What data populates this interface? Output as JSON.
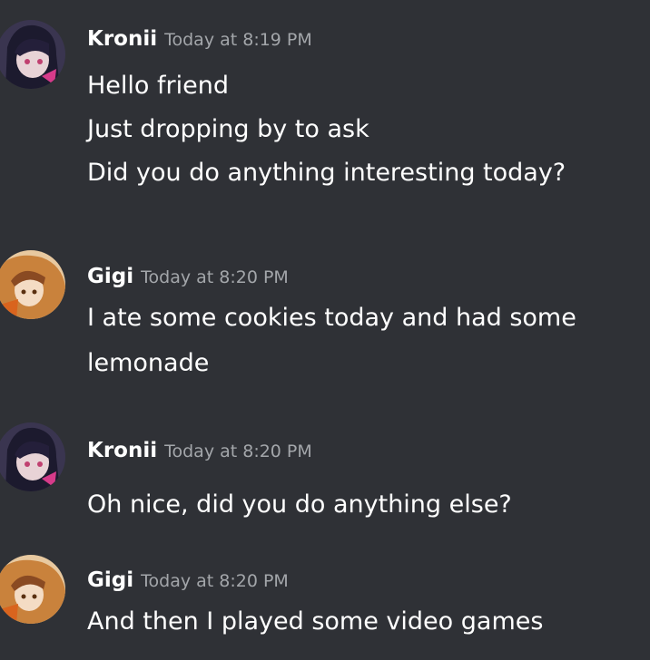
{
  "colors": {
    "background": "#2f3136",
    "username": "#ffffff",
    "timestamp": "#a3a6aa",
    "message_text": "#ffffff"
  },
  "messages": [
    {
      "author": "Kronii",
      "timestamp": "Today at 8:19 PM",
      "avatar_icon": "kronii-avatar",
      "lines": [
        "Hello friend",
        "Just dropping by to ask",
        "Did you do anything interesting today?"
      ]
    },
    {
      "author": "Gigi",
      "timestamp": "Today at 8:20 PM",
      "avatar_icon": "gigi-avatar",
      "lines": [
        "I ate some cookies today and had some",
        "lemonade"
      ]
    },
    {
      "author": "Kronii",
      "timestamp": "Today at 8:20 PM",
      "avatar_icon": "kronii-avatar",
      "lines": [
        "Oh nice, did you do anything else?"
      ]
    },
    {
      "author": "Gigi",
      "timestamp": "Today at 8:20 PM",
      "avatar_icon": "gigi-avatar",
      "lines": [
        "And then I played some video games"
      ]
    }
  ]
}
